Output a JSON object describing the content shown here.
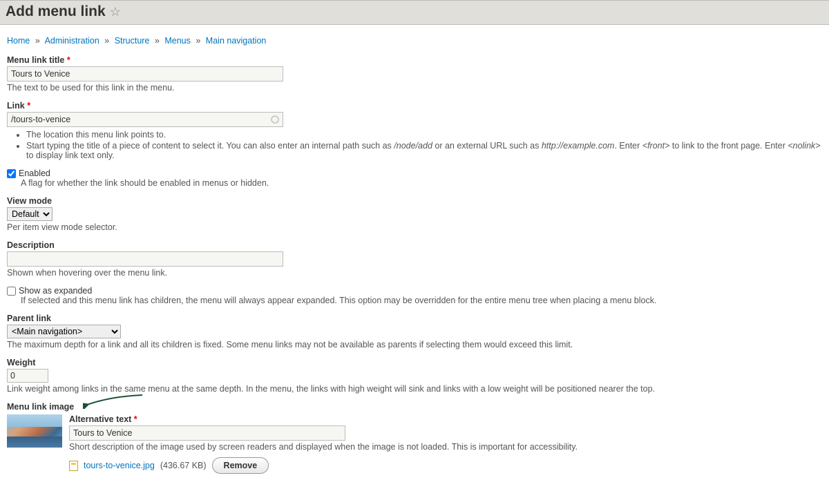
{
  "header": {
    "title": "Add menu link"
  },
  "breadcrumb": [
    {
      "label": "Home"
    },
    {
      "label": "Administration"
    },
    {
      "label": "Structure"
    },
    {
      "label": "Menus"
    },
    {
      "label": "Main navigation"
    }
  ],
  "fields": {
    "title": {
      "label": "Menu link title",
      "value": "Tours to Venice",
      "desc": "The text to be used for this link in the menu."
    },
    "link": {
      "label": "Link",
      "value": "/tours-to-venice",
      "hint1": "The location this menu link points to.",
      "hint2_pre": "Start typing the title of a piece of content to select it. You can also enter an internal path such as ",
      "hint2_em1": "/node/add",
      "hint2_mid1": " or an external URL such as ",
      "hint2_em2": "http://example.com",
      "hint2_mid2": ". Enter ",
      "hint2_em3": "<front>",
      "hint2_mid3": " to link to the front page. Enter ",
      "hint2_em4": "<nolink>",
      "hint2_end": " to display link text only."
    },
    "enabled": {
      "label": "Enabled",
      "desc": "A flag for whether the link should be enabled in menus or hidden."
    },
    "viewmode": {
      "label": "View mode",
      "selected": "Default",
      "desc": "Per item view mode selector."
    },
    "description": {
      "label": "Description",
      "value": "",
      "desc": "Shown when hovering over the menu link."
    },
    "expanded": {
      "label": "Show as expanded",
      "desc": "If selected and this menu link has children, the menu will always appear expanded. This option may be overridden for the entire menu tree when placing a menu block."
    },
    "parent": {
      "label": "Parent link",
      "selected": "<Main navigation>",
      "desc": "The maximum depth for a link and all its children is fixed. Some menu links may not be available as parents if selecting them would exceed this limit."
    },
    "weight": {
      "label": "Weight",
      "value": "0",
      "desc": "Link weight among links in the same menu at the same depth. In the menu, the links with high weight will sink and links with a low weight will be positioned nearer the top."
    },
    "image": {
      "label": "Menu link image",
      "alt_label": "Alternative text",
      "alt_value": "Tours to Venice",
      "alt_desc": "Short description of the image used by screen readers and displayed when the image is not loaded. This is important for accessibility.",
      "filename": "tours-to-venice.jpg",
      "filesize": "(436.67 KB)",
      "remove": "Remove"
    }
  }
}
